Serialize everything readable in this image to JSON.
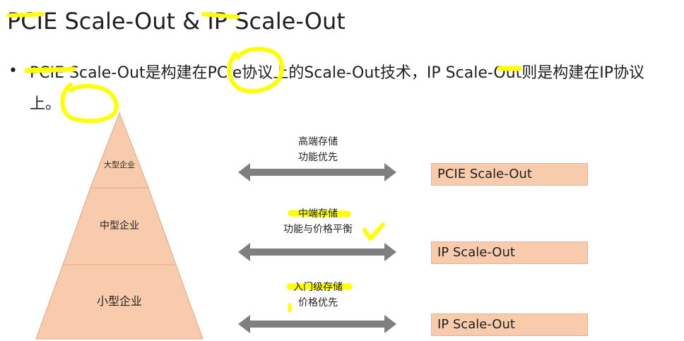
{
  "title": "PCIE Scale-Out & IP Scale-Out",
  "bullet": "PCIE  Scale-Out是构建在PCIe协议上的Scale-Out技术，IP  Scale-Out则是构建在IP协议上。",
  "pyramid": {
    "tiers": [
      "大型企业",
      "中型企业",
      "小型企业"
    ]
  },
  "rows": [
    {
      "caption_line1": "高端存储",
      "caption_line2": "功能优先",
      "box": "PCIE Scale-Out"
    },
    {
      "caption_line1": "中端存储",
      "caption_line2": "功能与价格平衡",
      "box": "IP Scale-Out"
    },
    {
      "caption_line1": "入门级存储",
      "caption_line2": "价格优先",
      "box": "IP Scale-Out"
    }
  ],
  "colors": {
    "pyramid_fill": "#f8cbad",
    "box_fill": "#f8cbad",
    "arrow": "#7f7f7f",
    "highlighter": "#ffff00"
  }
}
